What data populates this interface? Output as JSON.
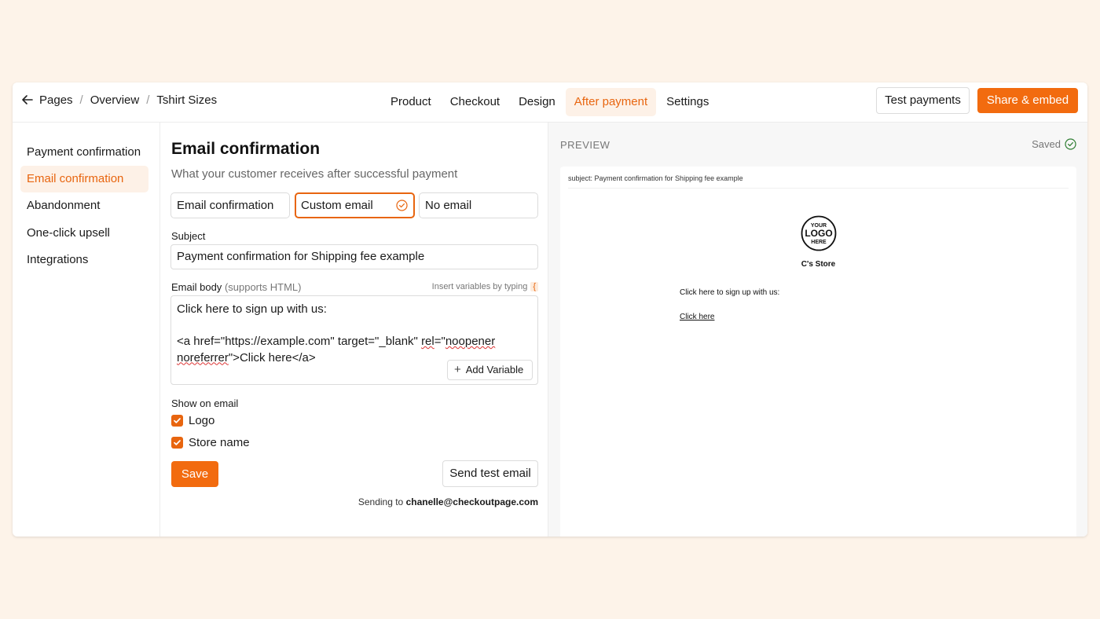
{
  "breadcrumb": [
    "Pages",
    "Overview",
    "Tshirt Sizes"
  ],
  "nav": [
    "Product",
    "Checkout",
    "Design",
    "After payment",
    "Settings"
  ],
  "nav_active": "After payment",
  "actions": {
    "test_payments": "Test payments",
    "share_embed": "Share & embed"
  },
  "sidebar": {
    "items": [
      "Payment confirmation",
      "Email confirmation",
      "Abandonment",
      "One-click upsell",
      "Integrations"
    ],
    "active": "Email confirmation"
  },
  "form": {
    "title": "Email confirmation",
    "subtitle": "What your customer receives after successful payment",
    "options": [
      "Email confirmation",
      "Custom email",
      "No email"
    ],
    "selected_option": "Custom email",
    "subject_label": "Subject",
    "subject_value": "Payment confirmation for Shipping fee example",
    "body_label": "Email body",
    "body_hint": "(supports HTML)",
    "insert_hint": "Insert variables by typing",
    "insert_char": "{",
    "body_lines": {
      "l1": "Click here to sign up with us:",
      "l3a": "<a href=\"https://example.com\" target=\"_blank\" ",
      "l3b": "rel",
      "l3c": "=\"",
      "l3d": "noopener",
      "l4a": "noreferrer",
      "l4b": "\">Click here</a>"
    },
    "add_variable": "Add Variable",
    "show_on_email": "Show on email",
    "show_logo": "Logo",
    "show_store_name": "Store name",
    "logo_checked": true,
    "store_checked": true,
    "save": "Save",
    "send_test": "Send test email",
    "sending_prefix": "Sending to",
    "sending_email": "chanelle@checkoutpage.com"
  },
  "preview": {
    "title": "PREVIEW",
    "status": "Saved",
    "subject_line": "subject: Payment confirmation for Shipping fee example",
    "logo_text": [
      "YOUR",
      "LOGO",
      "HERE"
    ],
    "store_name": "C's Store",
    "body_text": "Click here to sign up with us:",
    "link_text": "Click here"
  },
  "colors": {
    "accent": "#f26b0f",
    "accent_text": "#e8650f",
    "page_bg": "#fdf3e9",
    "saved_icon": "#2e7d32"
  },
  "icons": {
    "back": "arrow-left-icon",
    "selected": "check-circle-icon",
    "add": "plus-icon",
    "checkbox": "check-icon",
    "saved": "check-circle-icon"
  }
}
